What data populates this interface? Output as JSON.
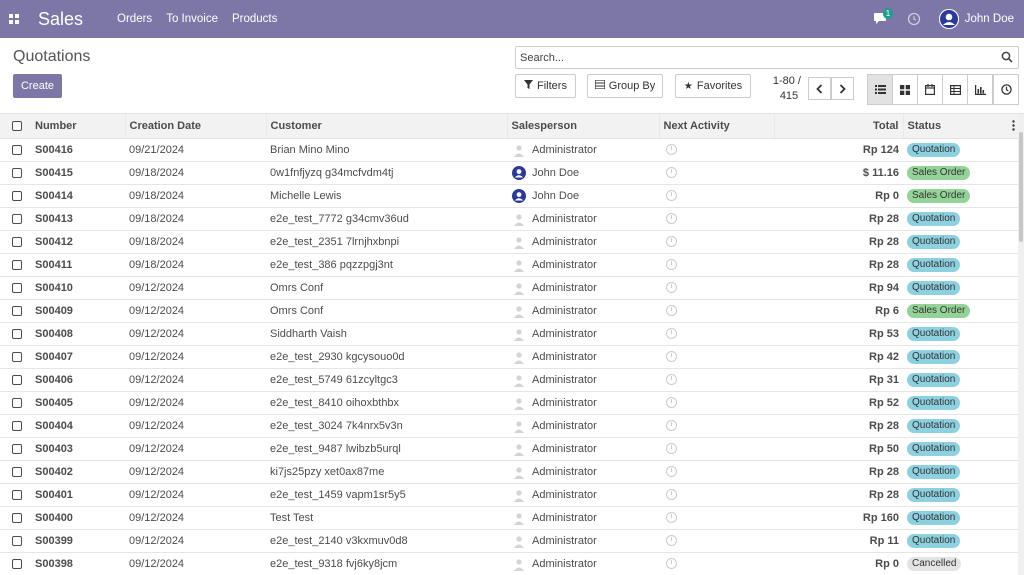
{
  "navbar": {
    "app_name": "Sales",
    "menu": [
      "Orders",
      "To Invoice",
      "Products"
    ],
    "chat_count": "1",
    "user_name": "John Doe"
  },
  "control_panel": {
    "title": "Quotations",
    "create_label": "Create",
    "search_placeholder": "Search...",
    "filters_label": "Filters",
    "group_by_label": "Group By",
    "favorites_label": "Favorites",
    "pager_range": "1-80 /",
    "pager_total": "415"
  },
  "table": {
    "columns": [
      "Number",
      "Creation Date",
      "Customer",
      "Salesperson",
      "Next Activity",
      "Total",
      "Status"
    ],
    "rows": [
      {
        "number": "S00416",
        "date": "09/21/2024",
        "customer": "Brian Mino Mino",
        "salesperson": "Administrator",
        "total": "Rp 124",
        "status": "Quotation"
      },
      {
        "number": "S00415",
        "date": "09/18/2024",
        "customer": "0w1fnfjyzq g34mcfvdm4tj",
        "salesperson": "John Doe",
        "total": "$ 11.16",
        "status": "Sales Order"
      },
      {
        "number": "S00414",
        "date": "09/18/2024",
        "customer": "Michelle Lewis",
        "salesperson": "John Doe",
        "total": "Rp 0",
        "status": "Sales Order"
      },
      {
        "number": "S00413",
        "date": "09/18/2024",
        "customer": "e2e_test_7772 g34cmv36ud",
        "salesperson": "Administrator",
        "total": "Rp 28",
        "status": "Quotation"
      },
      {
        "number": "S00412",
        "date": "09/18/2024",
        "customer": "e2e_test_2351 7lrnjhxbnpi",
        "salesperson": "Administrator",
        "total": "Rp 28",
        "status": "Quotation"
      },
      {
        "number": "S00411",
        "date": "09/18/2024",
        "customer": "e2e_test_386 pqzzpgj3nt",
        "salesperson": "Administrator",
        "total": "Rp 28",
        "status": "Quotation"
      },
      {
        "number": "S00410",
        "date": "09/12/2024",
        "customer": "Omrs Conf",
        "salesperson": "Administrator",
        "total": "Rp 94",
        "status": "Quotation"
      },
      {
        "number": "S00409",
        "date": "09/12/2024",
        "customer": "Omrs Conf",
        "salesperson": "Administrator",
        "total": "Rp 6",
        "status": "Sales Order"
      },
      {
        "number": "S00408",
        "date": "09/12/2024",
        "customer": "Siddharth Vaish",
        "salesperson": "Administrator",
        "total": "Rp 53",
        "status": "Quotation"
      },
      {
        "number": "S00407",
        "date": "09/12/2024",
        "customer": "e2e_test_2930 kgcysouo0d",
        "salesperson": "Administrator",
        "total": "Rp 42",
        "status": "Quotation"
      },
      {
        "number": "S00406",
        "date": "09/12/2024",
        "customer": "e2e_test_5749 61zcyltgc3",
        "salesperson": "Administrator",
        "total": "Rp 31",
        "status": "Quotation"
      },
      {
        "number": "S00405",
        "date": "09/12/2024",
        "customer": "e2e_test_8410 oihoxbthbx",
        "salesperson": "Administrator",
        "total": "Rp 52",
        "status": "Quotation"
      },
      {
        "number": "S00404",
        "date": "09/12/2024",
        "customer": "e2e_test_3024 7k4nrx5v3n",
        "salesperson": "Administrator",
        "total": "Rp 28",
        "status": "Quotation"
      },
      {
        "number": "S00403",
        "date": "09/12/2024",
        "customer": "e2e_test_9487 lwibzb5urql",
        "salesperson": "Administrator",
        "total": "Rp 50",
        "status": "Quotation"
      },
      {
        "number": "S00402",
        "date": "09/12/2024",
        "customer": "ki7js25pzy xet0ax87me",
        "salesperson": "Administrator",
        "total": "Rp 28",
        "status": "Quotation"
      },
      {
        "number": "S00401",
        "date": "09/12/2024",
        "customer": "e2e_test_1459 vapm1sr5y5",
        "salesperson": "Administrator",
        "total": "Rp 28",
        "status": "Quotation"
      },
      {
        "number": "S00400",
        "date": "09/12/2024",
        "customer": "Test Test",
        "salesperson": "Administrator",
        "total": "Rp 160",
        "status": "Quotation"
      },
      {
        "number": "S00399",
        "date": "09/12/2024",
        "customer": "e2e_test_2140 v3kxmuv0d8",
        "salesperson": "Administrator",
        "total": "Rp 11",
        "status": "Quotation"
      },
      {
        "number": "S00398",
        "date": "09/12/2024",
        "customer": "e2e_test_9318 fvj6ky8jcm",
        "salesperson": "Administrator",
        "total": "Rp 0",
        "status": "Cancelled"
      }
    ]
  }
}
